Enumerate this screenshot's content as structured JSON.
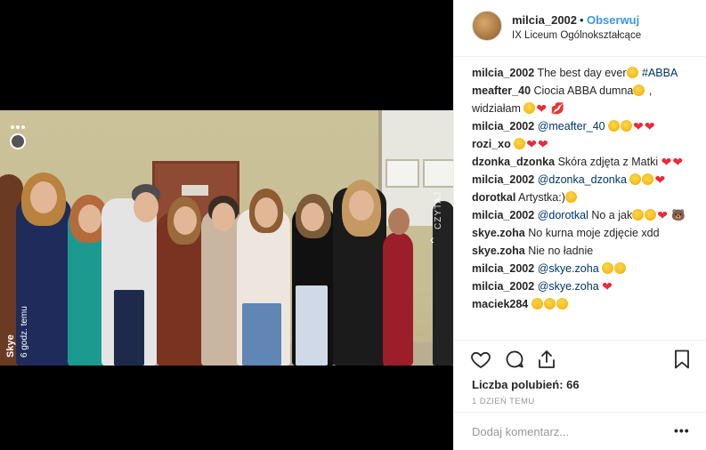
{
  "post": {
    "username": "milcia_2002",
    "dot": "•",
    "follow_label": "Obserwuj",
    "location": "IX Liceum Ogólnokształcące"
  },
  "overlay": {
    "story_user": "Skye",
    "story_time": "6 godz. temu",
    "read_more": "CZYTAJ"
  },
  "comments": [
    {
      "user": "milcia_2002",
      "parts": [
        {
          "t": "text",
          "v": "The best day ever"
        },
        {
          "t": "emoji",
          "v": "heart-eyes-emoji"
        },
        {
          "t": "text",
          "v": " "
        },
        {
          "t": "tag",
          "v": "#ABBA"
        }
      ]
    },
    {
      "user": "meafter_40",
      "parts": [
        {
          "t": "text",
          "v": "Ciocia ABBA dumna"
        },
        {
          "t": "emoji",
          "v": "tongue-emoji"
        },
        {
          "t": "text",
          "v": " , widziałam "
        },
        {
          "t": "emoji",
          "v": "laugh-emoji"
        },
        {
          "t": "heart",
          "v": "❤"
        },
        {
          "t": "text",
          "v": " 💋"
        }
      ]
    },
    {
      "user": "milcia_2002",
      "parts": [
        {
          "t": "mention",
          "v": "@meafter_40"
        },
        {
          "t": "text",
          "v": " "
        },
        {
          "t": "emoji",
          "v": "laugh-emoji"
        },
        {
          "t": "emoji",
          "v": "heart-eyes-emoji"
        },
        {
          "t": "heart",
          "v": "❤"
        },
        {
          "t": "heart",
          "v": "❤"
        }
      ]
    },
    {
      "user": "rozi_xo",
      "parts": [
        {
          "t": "emoji",
          "v": "heart-eyes-emoji"
        },
        {
          "t": "heart",
          "v": "❤"
        },
        {
          "t": "heart",
          "v": "❤"
        }
      ]
    },
    {
      "user": "dzonka_dzonka",
      "parts": [
        {
          "t": "text",
          "v": "Skóra zdjęta z Matki "
        },
        {
          "t": "heart",
          "v": "❤"
        },
        {
          "t": "heart",
          "v": "❤"
        }
      ]
    },
    {
      "user": "milcia_2002",
      "parts": [
        {
          "t": "mention",
          "v": "@dzonka_dzonka"
        },
        {
          "t": "text",
          "v": " "
        },
        {
          "t": "emoji",
          "v": "laugh-emoji"
        },
        {
          "t": "emoji",
          "v": "laugh-emoji"
        },
        {
          "t": "heart",
          "v": "❤"
        }
      ]
    },
    {
      "user": "dorotkal",
      "parts": [
        {
          "t": "text",
          "v": "Artystka:)"
        },
        {
          "t": "emoji",
          "v": "kiss-emoji"
        }
      ]
    },
    {
      "user": "milcia_2002",
      "parts": [
        {
          "t": "mention",
          "v": "@dorotkal"
        },
        {
          "t": "text",
          "v": " No a jak"
        },
        {
          "t": "emoji",
          "v": "laugh-emoji"
        },
        {
          "t": "emoji",
          "v": "laugh-emoji"
        },
        {
          "t": "heart",
          "v": "❤"
        },
        {
          "t": "text",
          "v": " 🐻"
        }
      ]
    },
    {
      "user": "skye.zoha",
      "parts": [
        {
          "t": "text",
          "v": "No kurna moje zdjęcie xdd"
        }
      ]
    },
    {
      "user": "skye.zoha",
      "parts": [
        {
          "t": "text",
          "v": "Nie no ładnie"
        }
      ]
    },
    {
      "user": "milcia_2002",
      "parts": [
        {
          "t": "mention",
          "v": "@skye.zoha"
        },
        {
          "t": "text",
          "v": " "
        },
        {
          "t": "emoji",
          "v": "laugh-emoji"
        },
        {
          "t": "emoji",
          "v": "laugh-emoji"
        }
      ]
    },
    {
      "user": "milcia_2002",
      "parts": [
        {
          "t": "mention",
          "v": "@skye.zoha"
        },
        {
          "t": "text",
          "v": " "
        },
        {
          "t": "heart",
          "v": "❤"
        }
      ]
    },
    {
      "user": "maciek284",
      "parts": [
        {
          "t": "emoji",
          "v": "surprised-emoji"
        },
        {
          "t": "emoji",
          "v": "surprised-emoji"
        },
        {
          "t": "emoji",
          "v": "surprised-emoji"
        }
      ]
    }
  ],
  "actions": {
    "like_icon": "heart-outline-icon",
    "comment_icon": "comment-icon",
    "share_icon": "share-icon",
    "save_icon": "bookmark-icon"
  },
  "likes_label": "Liczba polubień: 66",
  "date_label": "1 DZIEŃ TEMU",
  "add_comment_placeholder": "Dodaj komentarz...",
  "more_label": "•••",
  "colors": {
    "accent": "#3897f0",
    "link": "#003569",
    "heart": "#ed2939"
  }
}
